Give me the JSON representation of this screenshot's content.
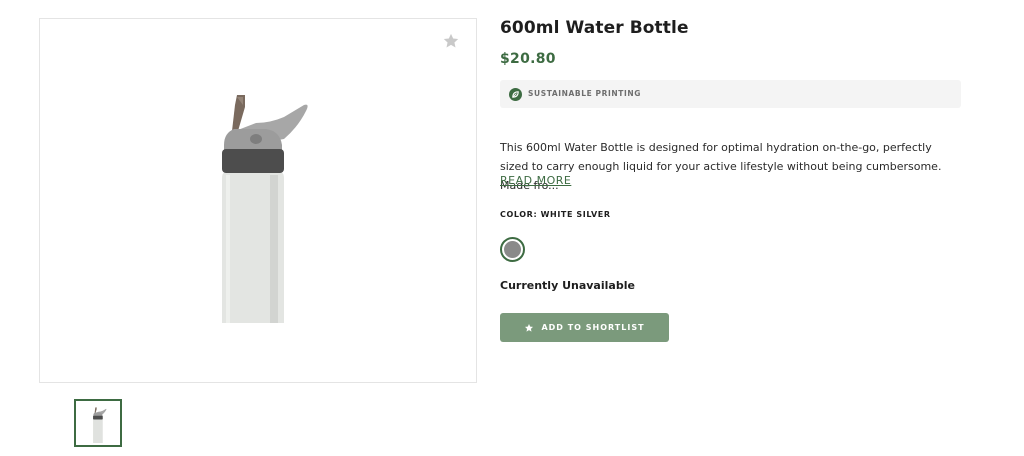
{
  "product": {
    "title": "600ml Water Bottle",
    "price": "$20.80",
    "badge": {
      "label": "SUSTAINABLE PRINTING",
      "icon": "leaf-icon"
    },
    "description": "This 600ml Water Bottle is designed for optimal hydration on-the-go, perfectly sized to carry enough liquid for your active lifestyle without being cumbersome. Made fro...",
    "read_more_label": "READ MORE",
    "color_label": "COLOR: WHITE SILVER",
    "availability": "Currently Unavailable",
    "shortlist_label": "ADD TO SHORTLIST"
  },
  "gallery": {
    "favorite_icon": "star-icon",
    "thumbnail_count": 1
  },
  "colors": {
    "accent": "#3d6b42",
    "button": "#7b9a7c",
    "swatch": "#8a8a8a",
    "badge_bg": "#f4f4f4"
  }
}
